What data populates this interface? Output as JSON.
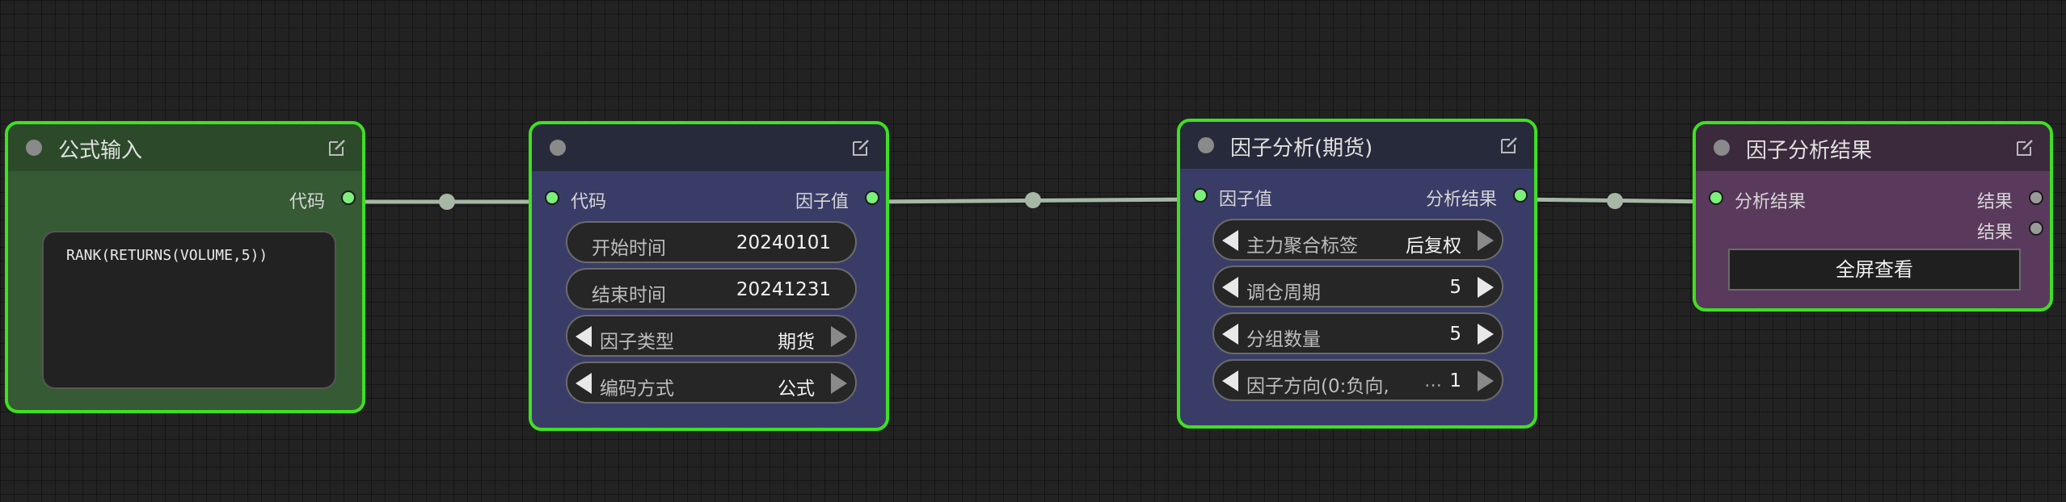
{
  "nodes": {
    "formula": {
      "title": "公式输入",
      "output": "代码",
      "formula_text": "RANK(RETURNS(VOLUME,5))"
    },
    "params": {
      "title": "",
      "input": "代码",
      "output": "因子值",
      "widgets": [
        {
          "label": "开始时间",
          "value": "20240101"
        },
        {
          "label": "结束时间",
          "value": "20241231"
        },
        {
          "label": "因子类型",
          "value": "期货"
        },
        {
          "label": "编码方式",
          "value": "公式"
        }
      ]
    },
    "analysis": {
      "title": "因子分析(期货)",
      "input": "因子值",
      "output": "分析结果",
      "widgets": [
        {
          "label": "主力聚合标签",
          "value": "后复权"
        },
        {
          "label": "调仓周期",
          "value": "5"
        },
        {
          "label": "分组数量",
          "value": "5"
        },
        {
          "label": "因子方向(0:负向,",
          "ellipsis": "...",
          "value": "1"
        }
      ]
    },
    "result": {
      "title": "因子分析结果",
      "input": "分析结果",
      "outputs": [
        "结果",
        "结果"
      ],
      "button": "全屏查看"
    }
  },
  "colors": {
    "background": "#222222",
    "selection_border": "#3fe021",
    "formula_body": "#365a34",
    "params_body": "#3a3c68",
    "result_body": "#5a3a5c",
    "link": "#9fb09f",
    "slot": "#7cf07a"
  }
}
